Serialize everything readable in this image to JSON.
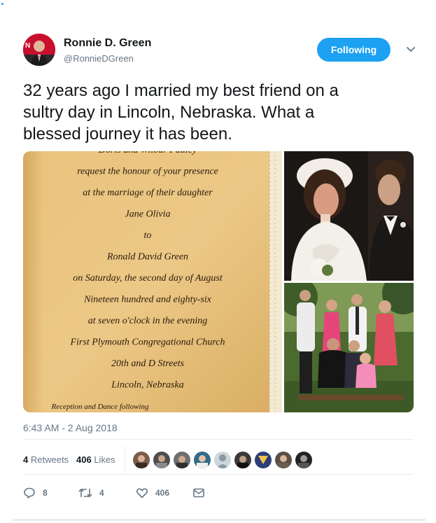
{
  "tweet": {
    "author_name": "Ronnie D. Green",
    "author_handle": "@RonnieDGreen",
    "follow_label": "Following",
    "text": "32 years ago I married my best friend on a\nsultry day in Lincoln, Nebraska.  What a\nblessed journey it has been.",
    "timestamp": "6:43 AM - 2 Aug 2018"
  },
  "invitation": {
    "lines": [
      "Doris and Wilbur Pauley",
      "request the honour of your presence",
      "at the marriage of their daughter",
      "Jane Olivia",
      "to",
      "Ronald David Green",
      "on Saturday, the second day of August",
      "Nineteen hundred and eighty-six",
      "at seven o'clock in the evening",
      "First Plymouth Congregational Church",
      "20th and D Streets",
      "Lincoln, Nebraska",
      "Reception and Dance following"
    ]
  },
  "stats": {
    "retweets_count": "4",
    "retweets_label": "Retweets",
    "likes_count": "406",
    "likes_label": "Likes"
  },
  "actions": {
    "reply_count": "8",
    "retweet_count": "4",
    "like_count": "406"
  },
  "icons": {
    "follow_menu": "chevron-down-icon",
    "reply": "reply-icon",
    "retweet": "retweet-icon",
    "like": "heart-icon",
    "dm": "envelope-icon"
  },
  "colors": {
    "accent": "#1da1f2",
    "text": "#14171a",
    "muted": "#657786",
    "border": "#e6ecf0"
  }
}
